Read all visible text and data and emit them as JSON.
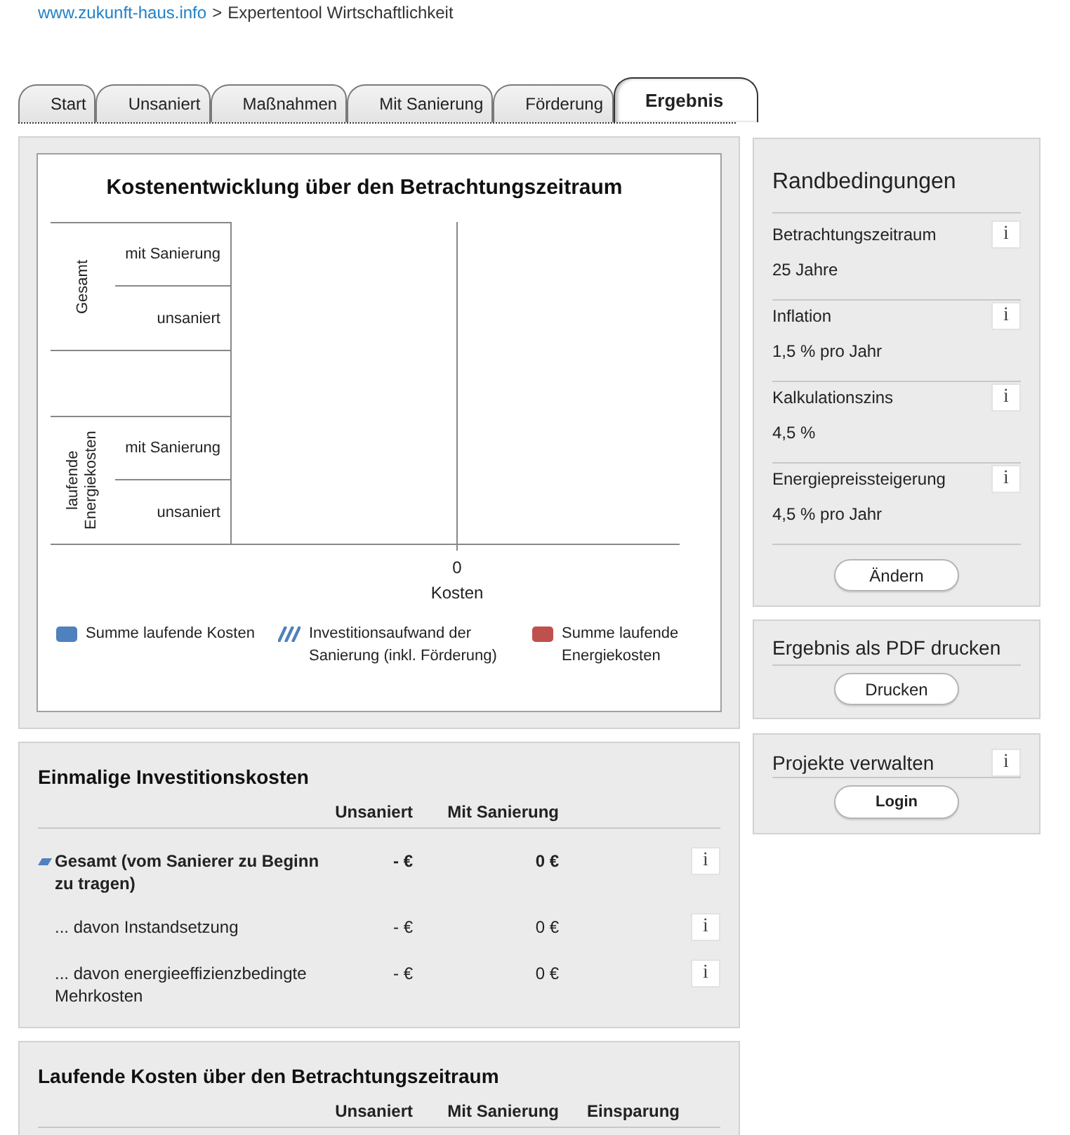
{
  "breadcrumb": {
    "link": "www.zukunft-haus.info",
    "separator": ">",
    "current": "Expertentool Wirtschaftlichkeit"
  },
  "tabs": [
    {
      "label": "Start",
      "selected": false
    },
    {
      "label": "Unsaniert",
      "selected": false
    },
    {
      "label": "Maßnahmen",
      "selected": false
    },
    {
      "label": "Mit Sanierung",
      "selected": false
    },
    {
      "label": "Förderung",
      "selected": false
    },
    {
      "label": "Ergebnis",
      "selected": true
    }
  ],
  "result_chart": {
    "title": "Kostenentwicklung über den Betrachtungszeitraum",
    "groups": [
      {
        "label": "Gesamt",
        "categories": [
          "mit Sanierung",
          "unsaniert"
        ]
      },
      {
        "label": "laufende Energiekosten",
        "categories": [
          "mit Sanierung",
          "unsaniert"
        ]
      }
    ],
    "axis_tick": "0",
    "axis_label": "Kosten",
    "legend": [
      {
        "label": "Summe laufende Kosten",
        "kind": "solid",
        "color": "#4f81bd"
      },
      {
        "label": "Investitionsaufwand der Sanierung (inkl. Förderung)",
        "kind": "hatched",
        "color": "#4f81bd"
      },
      {
        "label": "Summe laufende Energiekosten",
        "kind": "solid",
        "color": "#c0504d"
      }
    ]
  },
  "investment_costs": {
    "title": "Einmalige Investitionskosten",
    "columns": [
      "Unsaniert",
      "Mit Sanierung"
    ],
    "rows": [
      {
        "kind": "total",
        "label": "Gesamt (vom Sanierer zu Beginn zu tragen)",
        "cells": [
          "- €",
          "0 €"
        ],
        "info": "i"
      },
      {
        "kind": "detail",
        "label": "... davon Instandsetzung",
        "cells": [
          "- €",
          "0 €"
        ],
        "info": "i"
      },
      {
        "kind": "detail",
        "label": "... davon energieeffizienzbedingte Mehrkosten",
        "cells": [
          "- €",
          "0 €"
        ],
        "info": "i"
      }
    ]
  },
  "running_costs": {
    "title": "Laufende Kosten über den Betrachtungszeitraum",
    "columns": [
      "Unsaniert",
      "Mit Sanierung",
      "Einsparung"
    ]
  },
  "sidebar": {
    "conditions": {
      "title": "Randbedingungen",
      "items": [
        {
          "label": "Betrachtungszeitraum",
          "value": "25 Jahre",
          "info": "i"
        },
        {
          "label": "Inflation",
          "value": "1,5 % pro Jahr",
          "info": "i"
        },
        {
          "label": "Kalkulationszins",
          "value": "4,5 %",
          "info": "i"
        },
        {
          "label": "Energiepreissteigerung",
          "value": "4,5 % pro Jahr",
          "info": "i"
        }
      ],
      "button": "Ändern"
    },
    "pdf": {
      "title": "Ergebnis als PDF drucken",
      "button": "Drucken"
    },
    "projects": {
      "title": "Projekte verwalten",
      "info": "i",
      "button": "Login"
    }
  }
}
